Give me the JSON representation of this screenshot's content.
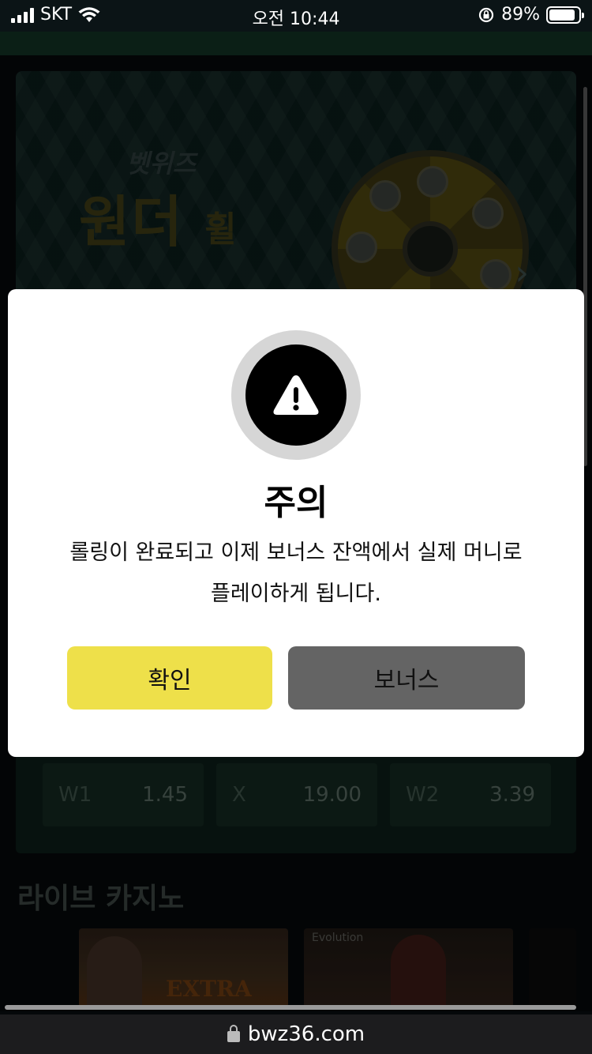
{
  "status_bar": {
    "carrier": "SKT",
    "time": "오전 10:44",
    "battery_percent": "89%",
    "battery_level": 0.89,
    "icons": [
      "signal-icon",
      "wifi-icon",
      "orientation-lock-icon",
      "battery-icon"
    ]
  },
  "banner": {
    "brand": "벳위즈",
    "title_main": "원더",
    "title_small": "휠"
  },
  "odds": [
    {
      "label": "W1",
      "value": "1.45"
    },
    {
      "label": "X",
      "value": "19.00"
    },
    {
      "label": "W2",
      "value": "3.39"
    }
  ],
  "live_casino": {
    "title": "라이브 카지노",
    "card1_tag": "EXTRA",
    "card2_tag": "Evolution"
  },
  "modal": {
    "icon": "warning-icon",
    "title": "주의",
    "message_line1": "롤링이 완료되고 이제 보너스 잔액에서 실제 머니로",
    "message_line2": "플레이하게 됩니다.",
    "confirm_label": "확인",
    "bonus_label": "보너스",
    "colors": {
      "confirm": "#eee04a",
      "bonus": "#646464"
    }
  },
  "browser": {
    "url": "bwz36.com",
    "icon": "lock-icon"
  }
}
